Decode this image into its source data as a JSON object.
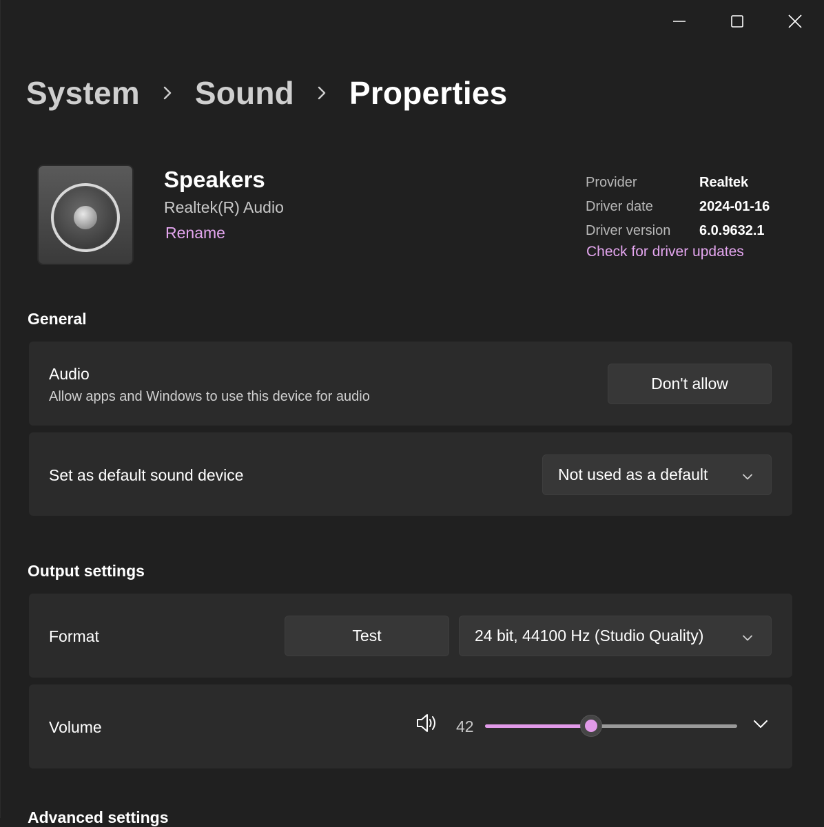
{
  "window": {
    "controls": [
      "minimize-icon",
      "maximize-icon",
      "close-icon"
    ]
  },
  "breadcrumb": {
    "items": [
      "System",
      "Sound"
    ],
    "current": "Properties"
  },
  "device": {
    "name": "Speakers",
    "description": "Realtek(R) Audio",
    "rename_label": "Rename",
    "icon": "speaker-icon"
  },
  "driver": {
    "provider_label": "Provider",
    "provider_value": "Realtek",
    "date_label": "Driver date",
    "date_value": "2024-01-16",
    "version_label": "Driver version",
    "version_value": "6.0.9632.1",
    "update_link": "Check for driver updates"
  },
  "general": {
    "title": "General",
    "audio": {
      "label": "Audio",
      "description": "Allow apps and Windows to use this device for audio",
      "button": "Don't allow"
    },
    "default_device": {
      "label": "Set as default sound device",
      "selected": "Not used as a default"
    }
  },
  "output": {
    "title": "Output settings",
    "format": {
      "label": "Format",
      "test_button": "Test",
      "selected": "24 bit, 44100 Hz (Studio Quality)"
    },
    "volume": {
      "label": "Volume",
      "value": "42",
      "fraction": 0.42
    }
  },
  "next_section": {
    "title": "Advanced settings"
  },
  "colors": {
    "accent": "#e19ae8",
    "link": "#e4a6ef",
    "background": "#202020",
    "card": "#2b2b2b"
  }
}
